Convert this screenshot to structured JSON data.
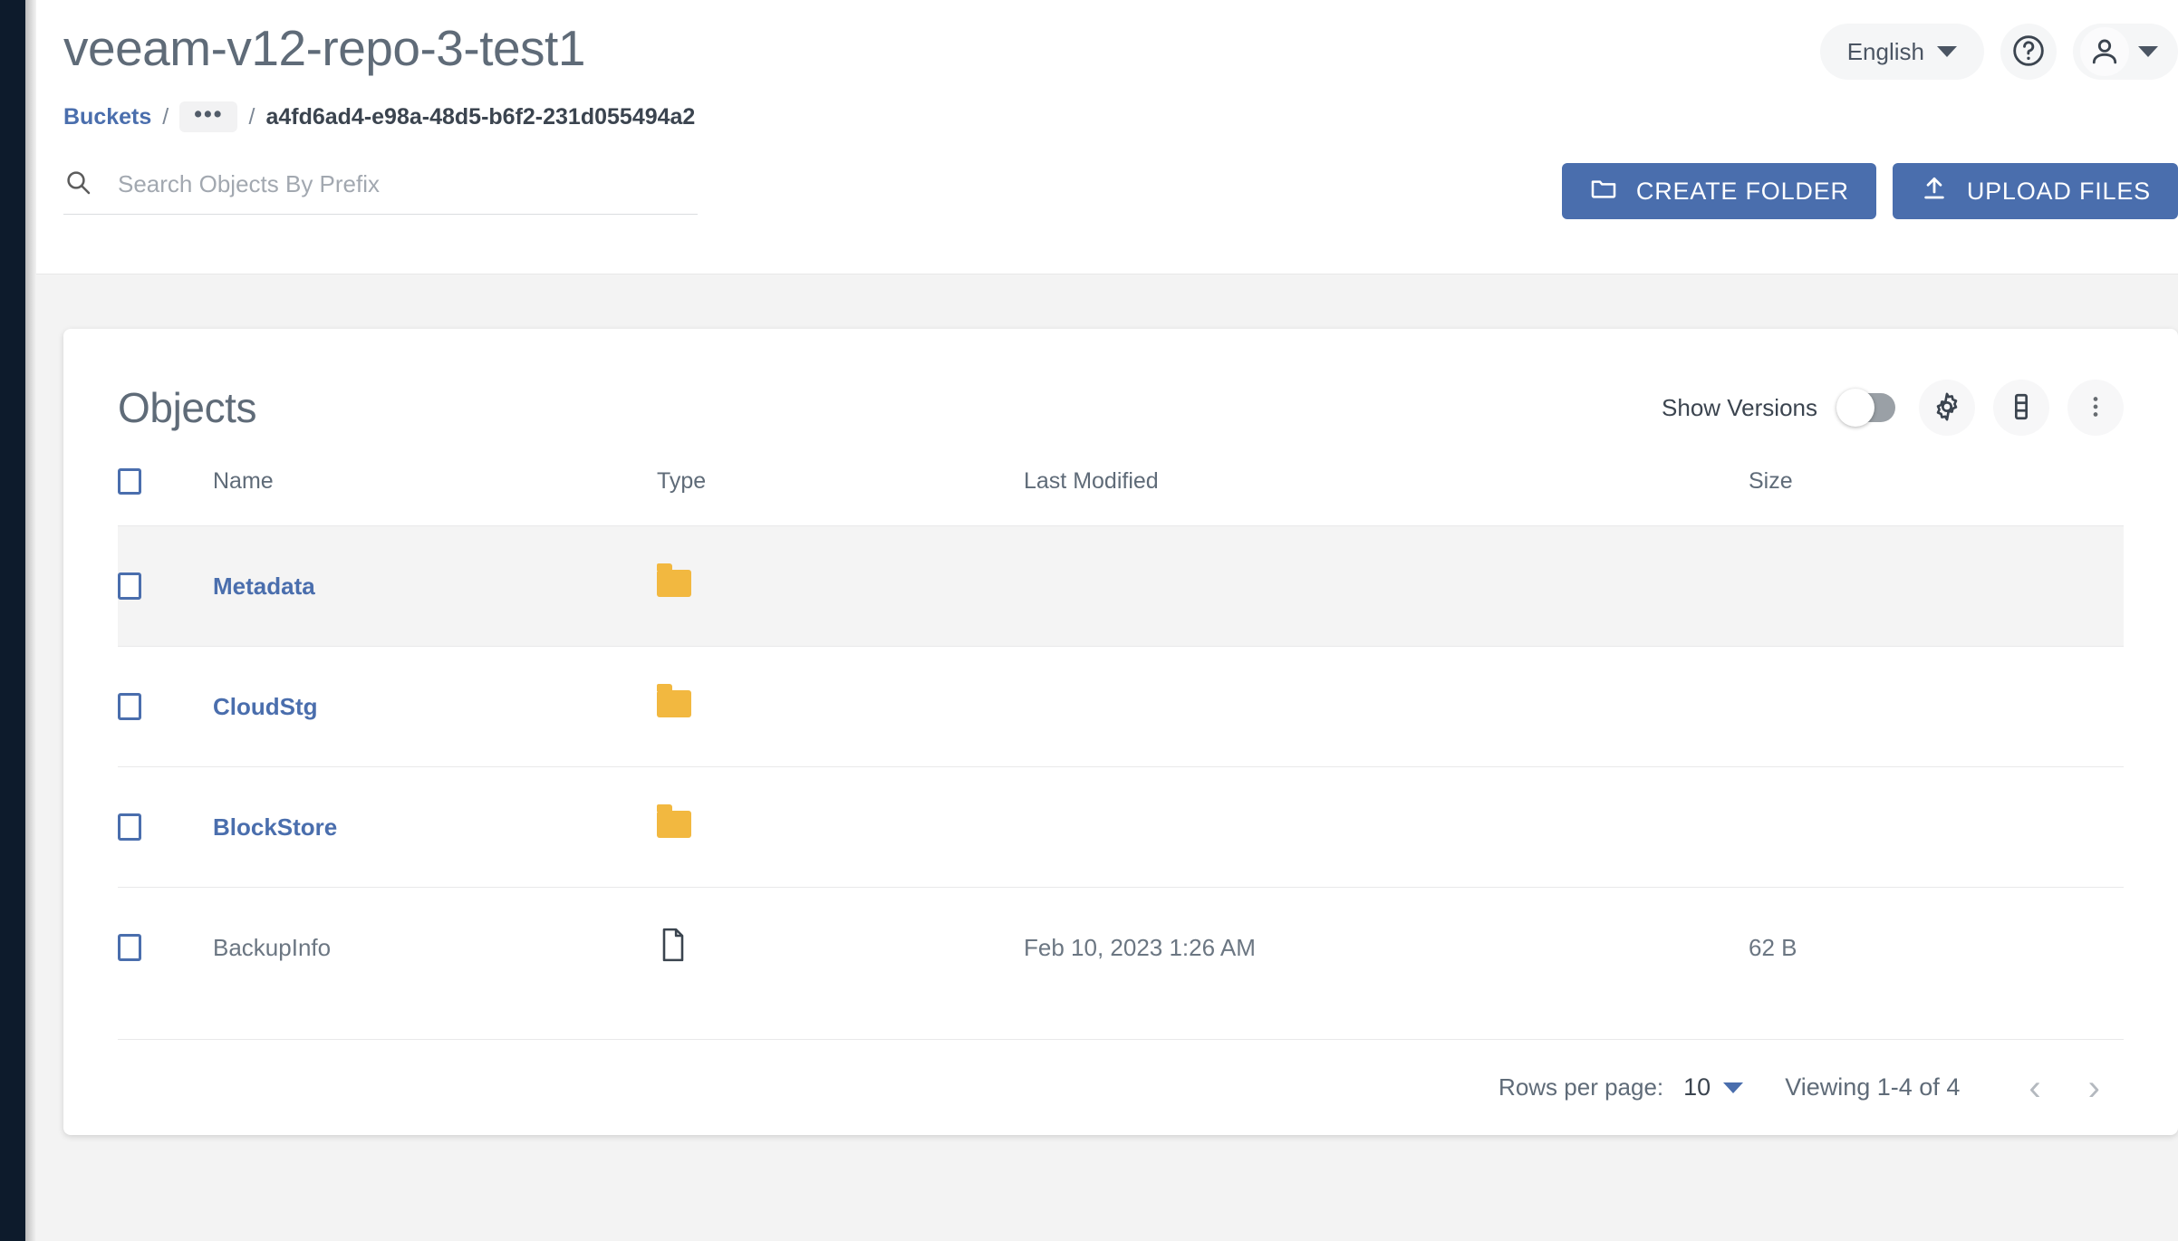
{
  "header": {
    "title": "veeam-v12-repo-3-test1",
    "language_label": "English",
    "help_icon": "help-circle-icon",
    "user_icon": "person-icon"
  },
  "breadcrumb": {
    "root": "Buckets",
    "sep": "/",
    "ellipsis": "•••",
    "current": "a4fd6ad4-e98a-48d5-b6f2-231d055494a2"
  },
  "search": {
    "placeholder": "Search Objects By Prefix",
    "value": "",
    "icon": "search-icon"
  },
  "actions": {
    "create_folder": "CREATE FOLDER",
    "upload_files": "UPLOAD FILES"
  },
  "card": {
    "title": "Objects",
    "show_versions_label": "Show Versions",
    "show_versions_on": false,
    "tools": [
      "gear-icon",
      "columns-icon",
      "more-vertical-icon"
    ]
  },
  "table": {
    "columns": [
      "Name",
      "Type",
      "Last Modified",
      "Size"
    ],
    "rows": [
      {
        "name": "Metadata",
        "kind": "folder",
        "type_icon": "folder-icon",
        "modified": "",
        "size": ""
      },
      {
        "name": "CloudStg",
        "kind": "folder",
        "type_icon": "folder-icon",
        "modified": "",
        "size": ""
      },
      {
        "name": "BlockStore",
        "kind": "folder",
        "type_icon": "folder-icon",
        "modified": "",
        "size": ""
      },
      {
        "name": "BackupInfo",
        "kind": "file",
        "type_icon": "document-icon",
        "modified": "Feb 10, 2023 1:26 AM",
        "size": "62 B"
      }
    ]
  },
  "footer": {
    "rows_per_page_label": "Rows per page:",
    "rows_per_page_value": "10",
    "viewing": "Viewing 1-4 of 4",
    "prev": "‹",
    "next": "›"
  },
  "colors": {
    "accent_blue": "#4a6ead",
    "folder_amber": "#f2b840",
    "rail_navy": "#0d1b2c",
    "page_bg": "#f3f3f3",
    "text_slate": "#5f6b78"
  }
}
